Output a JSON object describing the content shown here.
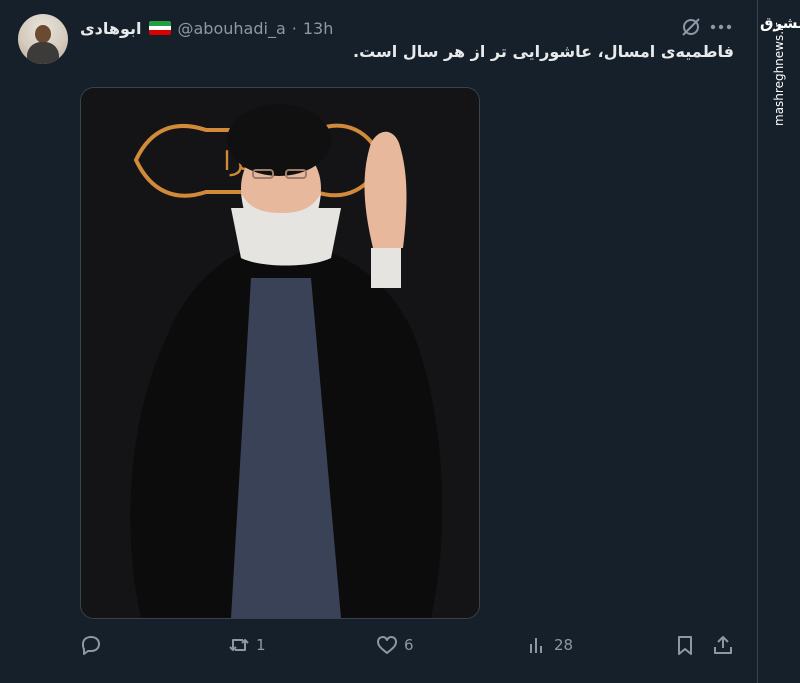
{
  "tweet": {
    "display_name": "ابوهادی",
    "handle": "@abouhadi_a",
    "separator": "·",
    "time": "13h",
    "text": "فاطمیه‌ی امسال، عاشورایی تر از هر سال است.",
    "media": {
      "banner_text": "یا زهرا",
      "colors": {
        "background": "#141416",
        "banner": "#d08a3a",
        "robe": "#0c0c0c",
        "inner_robe": "#3a4258",
        "skin": "#e7b89c",
        "beard": "#e6e4e0"
      }
    }
  },
  "actions": {
    "reply": {
      "icon": "reply-icon",
      "count": ""
    },
    "retweet": {
      "icon": "retweet-icon",
      "count": "1"
    },
    "like": {
      "icon": "heart-icon",
      "count": "6"
    },
    "views": {
      "icon": "views-icon",
      "count": "28"
    },
    "bookmark": {
      "icon": "bookmark-icon"
    },
    "share": {
      "icon": "share-icon"
    }
  },
  "watermark": {
    "logo": "مشرق",
    "site": "mashreghnews.ir"
  },
  "flag_colors": [
    "#239f40",
    "#ffffff",
    "#da0000"
  ],
  "theme": {
    "background": "#16202b",
    "text": "#e7e9ea",
    "muted": "#8b98a5",
    "border": "#38444d"
  }
}
